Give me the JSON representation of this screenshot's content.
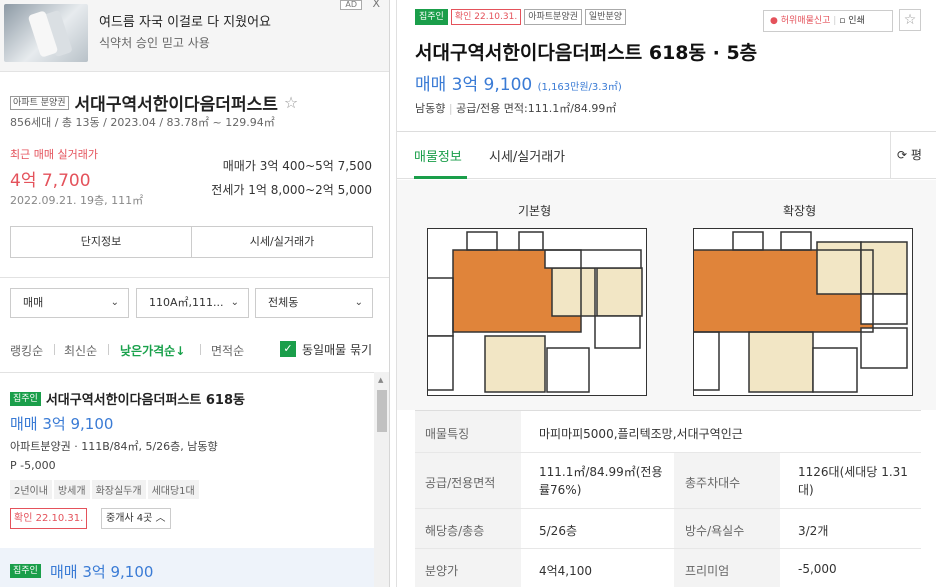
{
  "ad": {
    "line1": "여드름 자국 이걸로 다 지웠어요",
    "line2": "식약처 승인 믿고 사용",
    "badge": "AD",
    "close": "X"
  },
  "complex": {
    "tag": "아파트 분양권",
    "name": "서대구역서한이다음더퍼스트",
    "meta": "856세대 / 총 13동 / 2023.04 / 83.78㎡ ~ 129.94㎡",
    "recent_label": "최근 매매 실거래가",
    "recent_price": "4억 7,700",
    "recent_date": "2022.09.21. 19층, 111㎡",
    "sale_label": "매매가",
    "sale_range": "3억 400~5억 7,500",
    "lease_label": "전세가",
    "lease_range": "1억 8,000~2억 5,000",
    "btn_info": "단지정보",
    "btn_price": "시세/실거래가"
  },
  "filters": {
    "type": "매매",
    "area": "110A㎡,111...",
    "dong": "전체동"
  },
  "sort": {
    "items": [
      "랭킹순",
      "최신순",
      "낮은가격순↓",
      "면적순"
    ],
    "group_label": "동일매물 묶기"
  },
  "listing": {
    "tag": "집주인",
    "title": "서대구역서한이다음더퍼스트 618동",
    "price": "매매 3억 9,100",
    "spec": "아파트분양권 · 111B/84㎡, 5/26층, 남동향",
    "premium": "P -5,000",
    "chips": [
      "2년이내",
      "방세개",
      "화장실두개",
      "세대당1대"
    ],
    "confirm": "확인 22.10.31.",
    "broker": "중개사 4곳"
  },
  "listing2": {
    "tag": "집주인",
    "price": "매매 3억 9,100"
  },
  "detail": {
    "tags": [
      "집주인",
      "확인 22.10.31.",
      "아파트분양권",
      "일반분양"
    ],
    "report": "허위매물신고",
    "print": "인쇄",
    "title": "서대구역서한이다음더퍼스트 618동 · 5층",
    "price": "매매 3억 9,100",
    "price_sub": "(1,163만원/3.3㎡)",
    "dir": "남동향",
    "area": "공급/전용 면적:111.1㎡/84.99㎡",
    "tab1": "매물정보",
    "tab2": "시세/실거래가",
    "tab_right": "평",
    "plan1": "기본형",
    "plan2": "확장형",
    "rows": {
      "feature_label": "매물특징",
      "feature": "마피마피5000,플리텍조망,서대구역인근",
      "area_label": "공급/전용면적",
      "area_val": "111.1㎡/84.99㎡(전용률76%)",
      "parking_label": "총주차대수",
      "parking_val": "1126대(세대당 1.31대)",
      "floor_label": "해당층/총층",
      "floor_val": "5/26층",
      "room_label": "방수/욕실수",
      "room_val": "3/2개",
      "presale_label": "분양가",
      "presale_val": "4억4,100",
      "premium_label": "프리미엄",
      "premium_val": "-5,000"
    }
  }
}
